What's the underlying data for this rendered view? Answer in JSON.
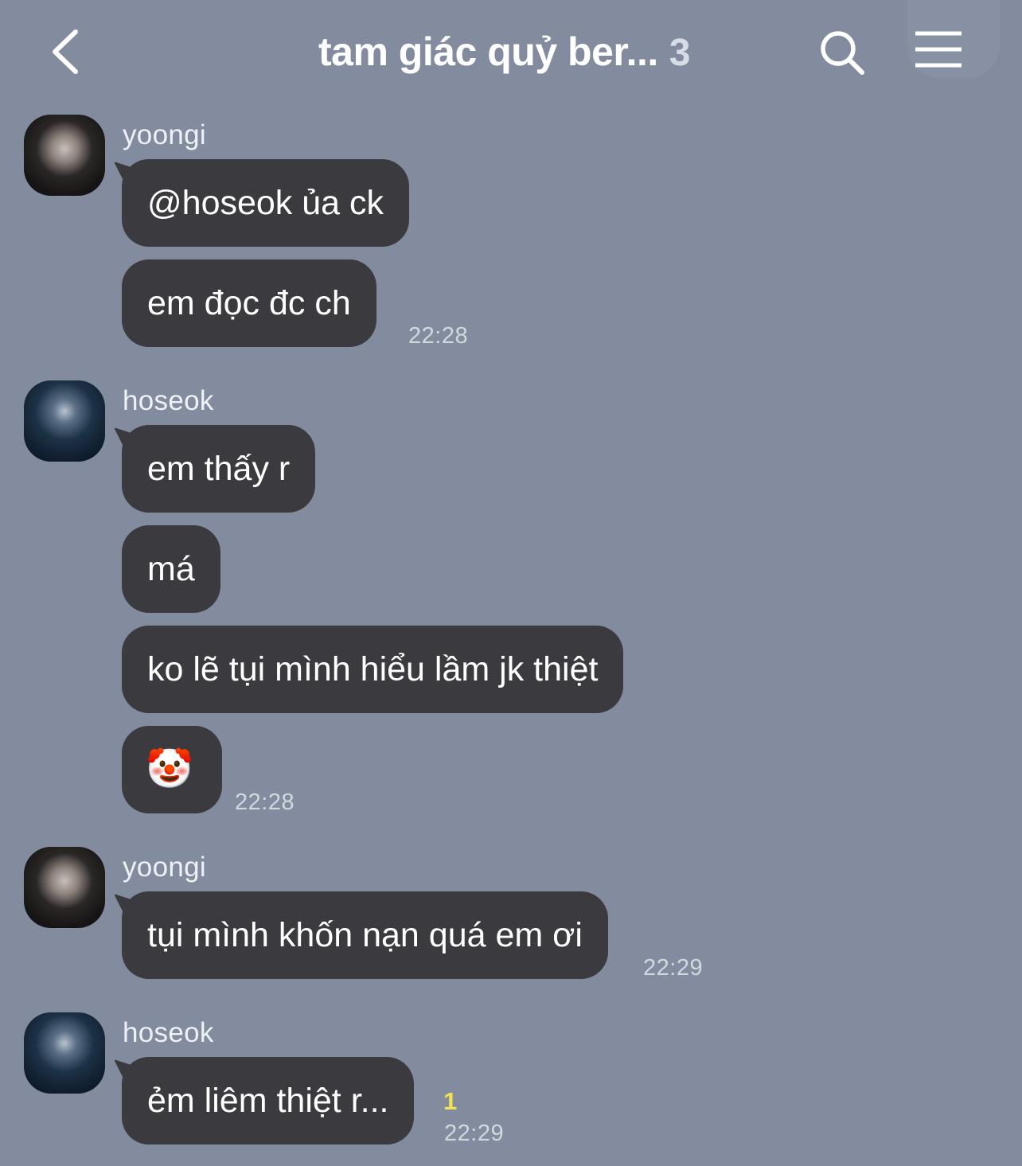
{
  "header": {
    "title": "tam giác quỷ ber...",
    "member_count": "3",
    "icons": {
      "back": "chevron-left-icon",
      "search": "search-icon",
      "menu": "hamburger-menu-icon"
    }
  },
  "messages": [
    {
      "sender": "yoongi",
      "avatar": "yoongi-avatar",
      "bubbles": [
        "@hoseok ủa ck",
        "em đọc đc ch"
      ],
      "time": "22:28"
    },
    {
      "sender": "hoseok",
      "avatar": "hoseok-avatar",
      "bubbles": [
        "em thấy r",
        "má",
        "ko lẽ tụi mình hiểu lầm jk thiệt",
        "🤡"
      ],
      "time": "22:28"
    },
    {
      "sender": "yoongi",
      "avatar": "yoongi-avatar",
      "bubbles": [
        "tụi mình khốn nạn quá em ơi"
      ],
      "time": "22:29"
    },
    {
      "sender": "hoseok",
      "avatar": "hoseok-avatar",
      "bubbles": [
        "ẻm liêm thiệt r..."
      ],
      "time": "22:29",
      "unread": "1"
    }
  ],
  "colors": {
    "background": "#828c9e",
    "bubble": "#3b3b3f",
    "bubble_text": "#ffffff",
    "unread": "#f3e24d"
  }
}
